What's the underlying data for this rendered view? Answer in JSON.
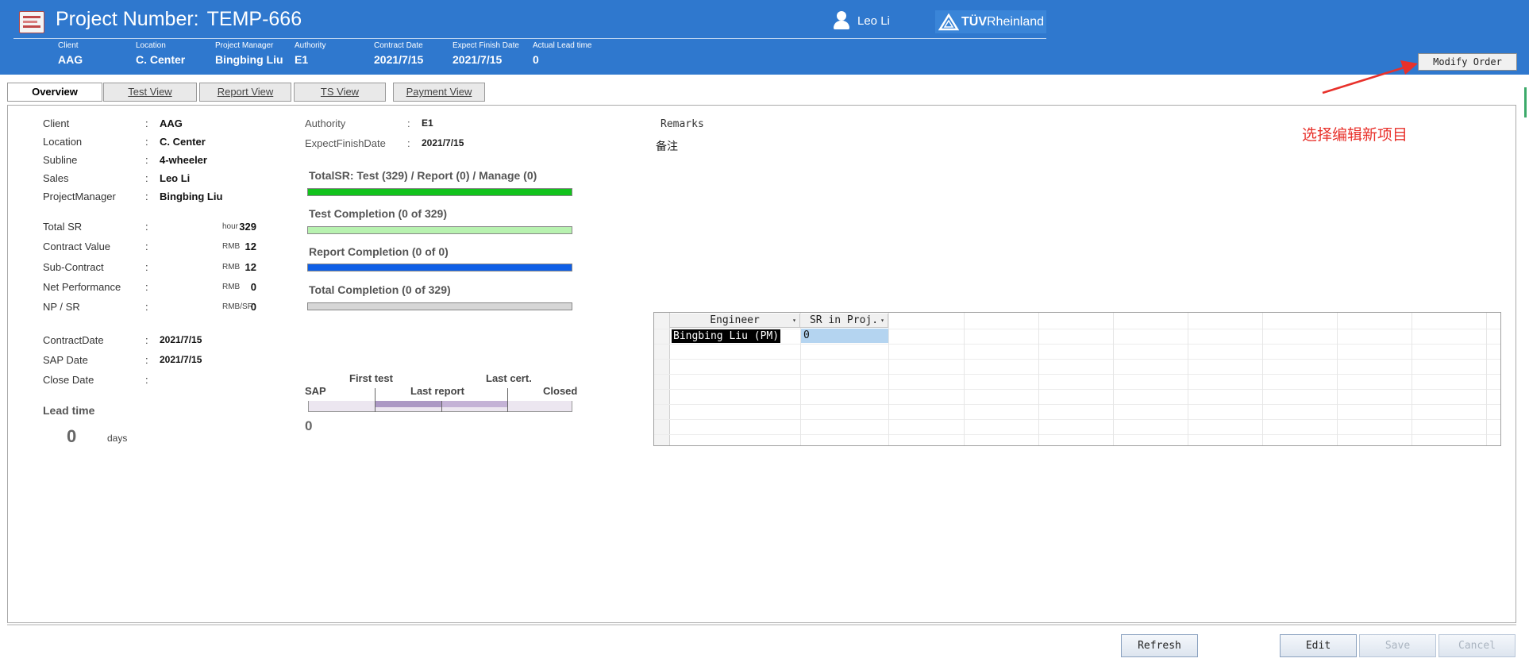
{
  "header": {
    "project_label": "Project Number:",
    "project_number": "TEMP-666",
    "user_name": "Leo Li",
    "logo_text_bold": "TÜV",
    "logo_text_rest": "Rheinland",
    "fields": [
      {
        "label": "Client",
        "value": "AAG"
      },
      {
        "label": "Location",
        "value": "C. Center"
      },
      {
        "label": "Project Manager",
        "value": "Bingbing Liu"
      },
      {
        "label": "Authority",
        "value": "E1"
      },
      {
        "label": "Contract Date",
        "value": "2021/7/15"
      },
      {
        "label": "Expect Finish Date",
        "value": "2021/7/15"
      },
      {
        "label": "Actual Lead time",
        "value": "0"
      }
    ],
    "modify_button": "Modify Order",
    "accent_color": "#2f78ce"
  },
  "tabs": [
    {
      "label": "Overview",
      "active": true
    },
    {
      "label": "Test View",
      "active": false
    },
    {
      "label": "Report View",
      "active": false
    },
    {
      "label": "TS View",
      "active": false
    },
    {
      "label": "Payment View",
      "active": false
    }
  ],
  "overview": {
    "info": [
      {
        "key": "Client",
        "value": "AAG"
      },
      {
        "key": "Location",
        "value": "C. Center"
      },
      {
        "key": "Subline",
        "value": "4-wheeler"
      },
      {
        "key": "Sales",
        "value": "Leo Li"
      },
      {
        "key": "ProjectManager",
        "value": "Bingbing Liu"
      }
    ],
    "financials": [
      {
        "key": "Total SR",
        "value": "329",
        "unit": "hour"
      },
      {
        "key": "Contract Value",
        "value": "12",
        "unit": "RMB"
      },
      {
        "key": "Sub-Contract",
        "value": "12",
        "unit": "RMB"
      },
      {
        "key": "Net Performance",
        "value": "0",
        "unit": "RMB"
      },
      {
        "key": "NP / SR",
        "value": "0",
        "unit": "RMB/SR"
      }
    ],
    "dates": [
      {
        "key": "ContractDate",
        "value": "2021/7/15"
      },
      {
        "key": "SAP Date",
        "value": "2021/7/15"
      },
      {
        "key": "Close Date",
        "value": ""
      }
    ],
    "separator": ":",
    "lead_time_label": "Lead time",
    "lead_time_value": "0",
    "lead_time_unit": "days",
    "authority_label": "Authority",
    "authority_value": "E1",
    "expect_finish_label": "ExpectFinishDate",
    "expect_finish_value": "2021/7/15",
    "progress": [
      {
        "label": "TotalSR: Test (329) / Report (0) / Manage (0)",
        "color": "#12c21c",
        "fill": 1.0
      },
      {
        "label": "Test Completion (0 of 329)",
        "color": "#b8f2b0",
        "fill": 1.0
      },
      {
        "label": "Report Completion (0 of 0)",
        "color": "#0f5fe6",
        "fill": 1.0
      },
      {
        "label": "Total Completion (0 of 329)",
        "color": "#d6d6d6",
        "fill": 1.0
      }
    ],
    "timeline": {
      "labels": [
        "SAP",
        "First test",
        "Last report",
        "Last cert.",
        "Closed"
      ],
      "value": "0"
    },
    "remarks_title": "Remarks",
    "remarks_text": "备注",
    "annotation_note": "选择编辑新项目",
    "annotation_color": "#e8312b"
  },
  "engineer_grid": {
    "columns": [
      "Engineer",
      "SR in Proj."
    ],
    "rows": [
      {
        "engineer": "Bingbing Liu (PM)",
        "sr": "0"
      }
    ]
  },
  "buttons": {
    "refresh": "Refresh",
    "edit": "Edit",
    "save": "Save",
    "cancel": "Cancel"
  }
}
